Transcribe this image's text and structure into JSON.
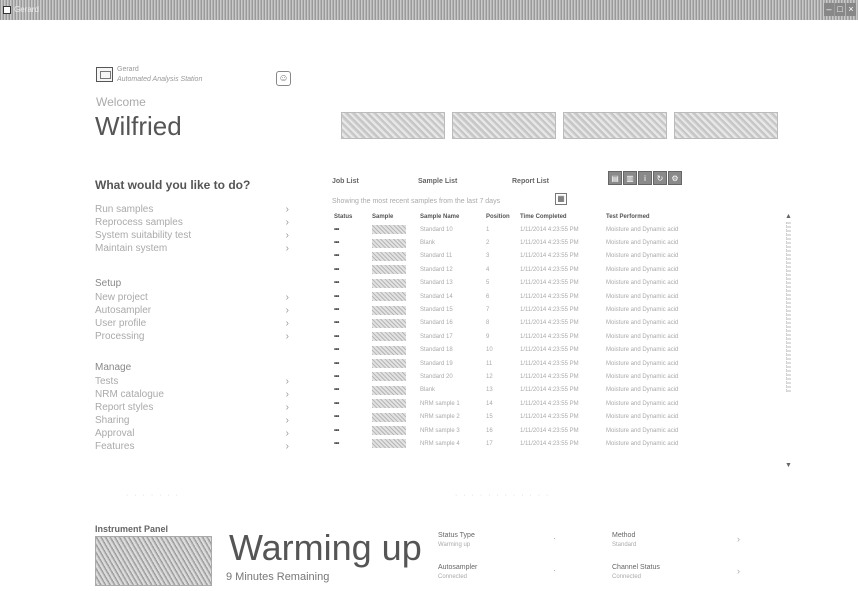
{
  "window": {
    "title": "Gerard"
  },
  "header": {
    "brand_line1": "Gerard",
    "brand_line2": "Automated Analysis Station",
    "welcome": "Welcome",
    "username": "Wilfried",
    "buttons": [
      "",
      "",
      "",
      ""
    ]
  },
  "sidebar": {
    "question": "What would you like to do?",
    "group_main": [
      "Run samples",
      "Reprocess samples",
      "System suitability test",
      "Maintain system"
    ],
    "setup_heading": "Setup",
    "group_setup": [
      "New project",
      "Autosampler",
      "User profile",
      "Processing"
    ],
    "manage_heading": "Manage",
    "group_manage": [
      "Tests",
      "NRM catalogue",
      "Report styles",
      "Sharing",
      "Approval",
      "Features"
    ]
  },
  "lists": {
    "tabs": [
      "Job List",
      "Sample List",
      "Report List"
    ],
    "filter_text": "Showing the most recent samples from the last 7 days",
    "columns": [
      "Status",
      "Sample",
      "Sample Name",
      "Position",
      "Time Completed",
      "Test Performed"
    ],
    "rows": [
      {
        "status": "•••",
        "name": "Standard 10",
        "pos": "1",
        "time": "1/11/2014 4:23:55 PM",
        "test": "Moisture and Dynamic acid"
      },
      {
        "status": "•••",
        "name": "Blank",
        "pos": "2",
        "time": "1/11/2014 4:23:55 PM",
        "test": "Moisture and Dynamic acid"
      },
      {
        "status": "•••",
        "name": "Standard 11",
        "pos": "3",
        "time": "1/11/2014 4:23:55 PM",
        "test": "Moisture and Dynamic acid"
      },
      {
        "status": "•••",
        "name": "Standard 12",
        "pos": "4",
        "time": "1/11/2014 4:23:55 PM",
        "test": "Moisture and Dynamic acid"
      },
      {
        "status": "•••",
        "name": "Standard 13",
        "pos": "5",
        "time": "1/11/2014 4:23:55 PM",
        "test": "Moisture and Dynamic acid"
      },
      {
        "status": "•••",
        "name": "Standard 14",
        "pos": "6",
        "time": "1/11/2014 4:23:55 PM",
        "test": "Moisture and Dynamic acid"
      },
      {
        "status": "•••",
        "name": "Standard 15",
        "pos": "7",
        "time": "1/11/2014 4:23:55 PM",
        "test": "Moisture and Dynamic acid"
      },
      {
        "status": "•••",
        "name": "Standard 16",
        "pos": "8",
        "time": "1/11/2014 4:23:55 PM",
        "test": "Moisture and Dynamic acid"
      },
      {
        "status": "•••",
        "name": "Standard 17",
        "pos": "9",
        "time": "1/11/2014 4:23:55 PM",
        "test": "Moisture and Dynamic acid"
      },
      {
        "status": "•••",
        "name": "Standard 18",
        "pos": "10",
        "time": "1/11/2014 4:23:55 PM",
        "test": "Moisture and Dynamic acid"
      },
      {
        "status": "•••",
        "name": "Standard 19",
        "pos": "11",
        "time": "1/11/2014 4:23:55 PM",
        "test": "Moisture and Dynamic acid"
      },
      {
        "status": "•••",
        "name": "Standard 20",
        "pos": "12",
        "time": "1/11/2014 4:23:55 PM",
        "test": "Moisture and Dynamic acid"
      },
      {
        "status": "•••",
        "name": "Blank",
        "pos": "13",
        "time": "1/11/2014 4:23:55 PM",
        "test": "Moisture and Dynamic acid"
      },
      {
        "status": "•••",
        "name": "NRM sample 1",
        "pos": "14",
        "time": "1/11/2014 4:23:55 PM",
        "test": "Moisture and Dynamic acid"
      },
      {
        "status": "•••",
        "name": "NRM sample 2",
        "pos": "15",
        "time": "1/11/2014 4:23:55 PM",
        "test": "Moisture and Dynamic acid"
      },
      {
        "status": "•••",
        "name": "NRM sample 3",
        "pos": "16",
        "time": "1/11/2014 4:23:55 PM",
        "test": "Moisture and Dynamic acid"
      },
      {
        "status": "•••",
        "name": "NRM sample 4",
        "pos": "17",
        "time": "1/11/2014 4:23:55 PM",
        "test": "Moisture and Dynamic acid"
      }
    ]
  },
  "instrument": {
    "title": "Instrument Panel",
    "status": "Warming up",
    "remaining": "9 Minutes Remaining",
    "kv1_label": "Status Type",
    "kv1_value": "Warming up",
    "kv2_label": "Method",
    "kv2_value": "Standard",
    "kv3_label": "Autosampler",
    "kv3_value": "Connected",
    "kv4_label": "Channel Status",
    "kv4_value": "Connected"
  }
}
